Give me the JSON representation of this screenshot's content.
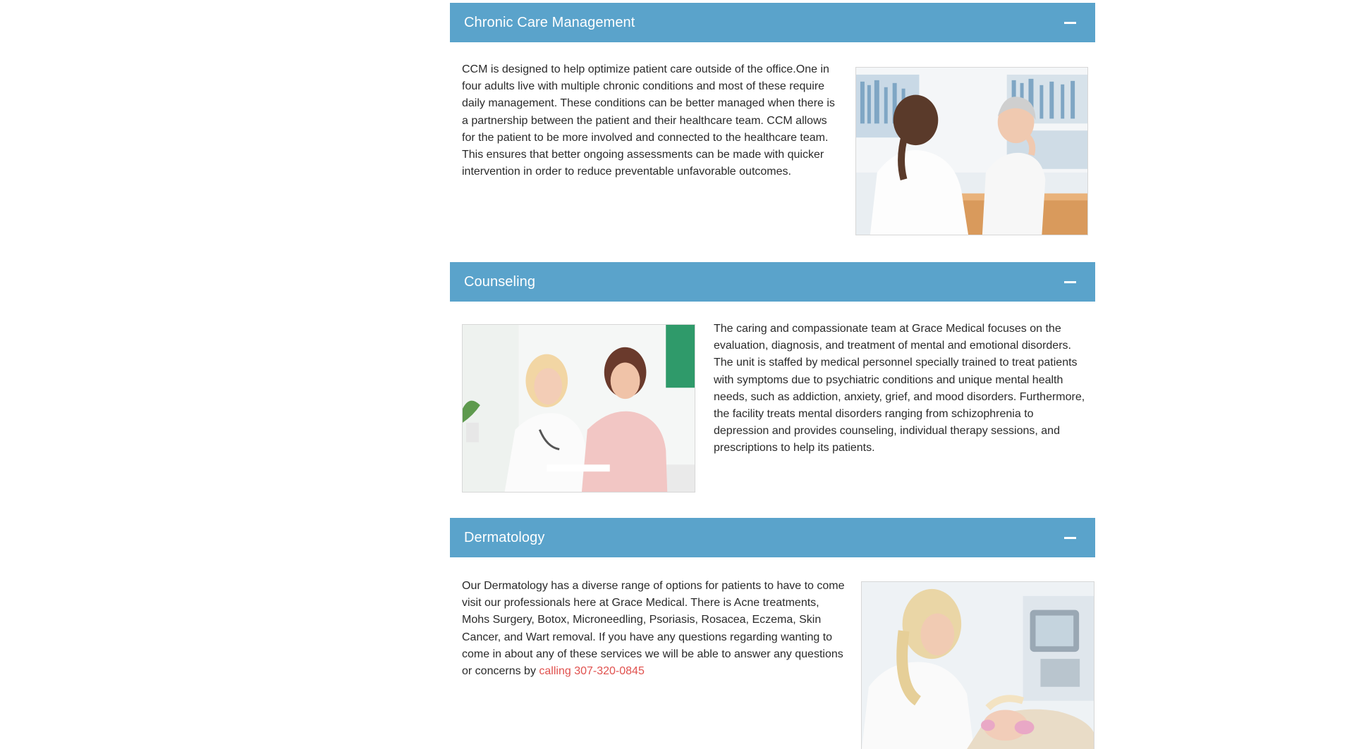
{
  "sections": {
    "ccm": {
      "title": "Chronic Care Management",
      "body": "CCM is designed to help optimize patient care outside of the office.One in four adults live with multiple chronic conditions and most of these require daily management. These conditions can be better managed when there is a partnership between the patient and their healthcare team. CCM allows for the patient to be more involved and connected to the healthcare team. This ensures that better ongoing assessments can be made with quicker intervention in order to reduce preventable unfavorable outcomes.",
      "image_icon": "doctor-consultation-photo"
    },
    "counseling": {
      "title": "Counseling",
      "body": "The caring and compassionate team at Grace Medical focuses on the evaluation, diagnosis, and treatment of mental and emotional disorders. The unit is staffed by medical personnel specially trained to treat patients with symptoms due to psychiatric conditions and unique mental health needs, such as addiction, anxiety, grief, and mood disorders. Furthermore, the facility treats mental disorders ranging from schizophrenia to depression and provides counseling, individual therapy sessions, and prescriptions to help its patients.",
      "image_icon": "counseling-session-photo"
    },
    "dermatology": {
      "title": "Dermatology",
      "body": "Our Dermatology has a diverse range of options for patients to have to come visit our professionals here at Grace Medical. There is Acne treatments, Mohs Surgery, Botox, Microneedling, Psoriasis, Rosacea, Eczema, Skin Cancer, and Wart removal. If you have any questions regarding wanting to come in about any of these services we will be able to answer any questions or concerns by",
      "link": "calling 307-320-0845",
      "image_icon": "dermatology-treatment-photo"
    }
  },
  "icons": {
    "collapse": "minus-icon"
  },
  "colors": {
    "header_bg": "#5aa3cb",
    "header_text": "#ffffff",
    "link": "#e0514e",
    "body_text": "#2a2a2a"
  }
}
